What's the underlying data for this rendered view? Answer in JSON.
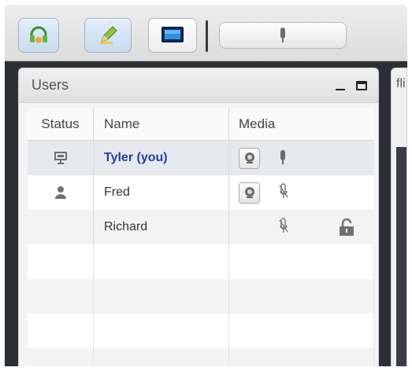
{
  "toolbar": {
    "buttons": [
      {
        "icon": "headset-icon",
        "active": true
      },
      {
        "icon": "pencil-icon",
        "active": true
      },
      {
        "icon": "desktop-icon",
        "active": false
      }
    ],
    "talk_icon": "microphone-icon"
  },
  "users_panel": {
    "title": "Users",
    "columns": [
      "Status",
      "Name",
      "Media"
    ],
    "rows": [
      {
        "status_icon": "presenter-icon",
        "name": "Tyler (you)",
        "webcam": true,
        "mic": "active-mic-icon",
        "lock": false,
        "selected": true
      },
      {
        "status_icon": "user-icon",
        "name": "Fred",
        "webcam": true,
        "mic": "muted-mic-icon",
        "lock": false,
        "selected": false
      },
      {
        "status_icon": "",
        "name": "Richard",
        "webcam": false,
        "mic": "muted-mic-icon",
        "lock": true,
        "selected": false
      }
    ]
  },
  "right_panel": {
    "title": "fli"
  },
  "colors": {
    "accent": "#22409a",
    "toolbar_active": "#c7dbef",
    "frame": "#2c2f33"
  }
}
